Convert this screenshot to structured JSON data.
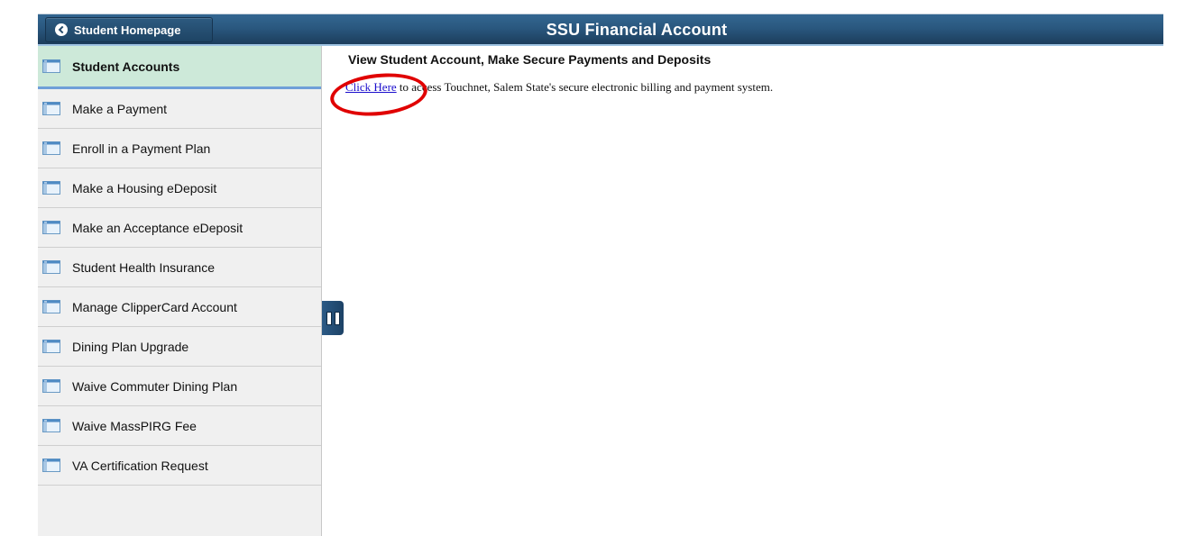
{
  "header": {
    "back_button_label": "Student Homepage",
    "title": "SSU Financial Account",
    "back_icon": "chevron-left-circle-icon"
  },
  "sidebar": {
    "items": [
      {
        "label": "Student Accounts",
        "active": true,
        "icon": "page-layout-icon"
      },
      {
        "label": "Make a Payment",
        "active": false,
        "icon": "page-layout-icon"
      },
      {
        "label": "Enroll in a Payment Plan",
        "active": false,
        "icon": "page-layout-icon"
      },
      {
        "label": "Make a Housing eDeposit",
        "active": false,
        "icon": "page-layout-icon"
      },
      {
        "label": "Make an Acceptance eDeposit",
        "active": false,
        "icon": "page-layout-icon"
      },
      {
        "label": "Student Health Insurance",
        "active": false,
        "icon": "page-layout-icon"
      },
      {
        "label": "Manage ClipperCard Account",
        "active": false,
        "icon": "page-layout-icon"
      },
      {
        "label": "Dining Plan Upgrade",
        "active": false,
        "icon": "page-layout-icon"
      },
      {
        "label": "Waive Commuter Dining Plan",
        "active": false,
        "icon": "page-layout-icon"
      },
      {
        "label": "Waive MassPIRG Fee",
        "active": false,
        "icon": "page-layout-icon"
      },
      {
        "label": "VA Certification Request",
        "active": false,
        "icon": "page-layout-icon"
      }
    ]
  },
  "main": {
    "section_title": "View Student Account, Make Secure Payments and Deposits",
    "link_text": "Click Here",
    "description_rest": " to access Touchnet, Salem State's secure electronic billing and payment system."
  },
  "colors": {
    "header_blue": "#2a587f",
    "active_item_bg": "#cde9d9",
    "active_item_underline": "#6f9fd8",
    "link": "#1a0dcc",
    "annotation_red": "#e00000"
  }
}
